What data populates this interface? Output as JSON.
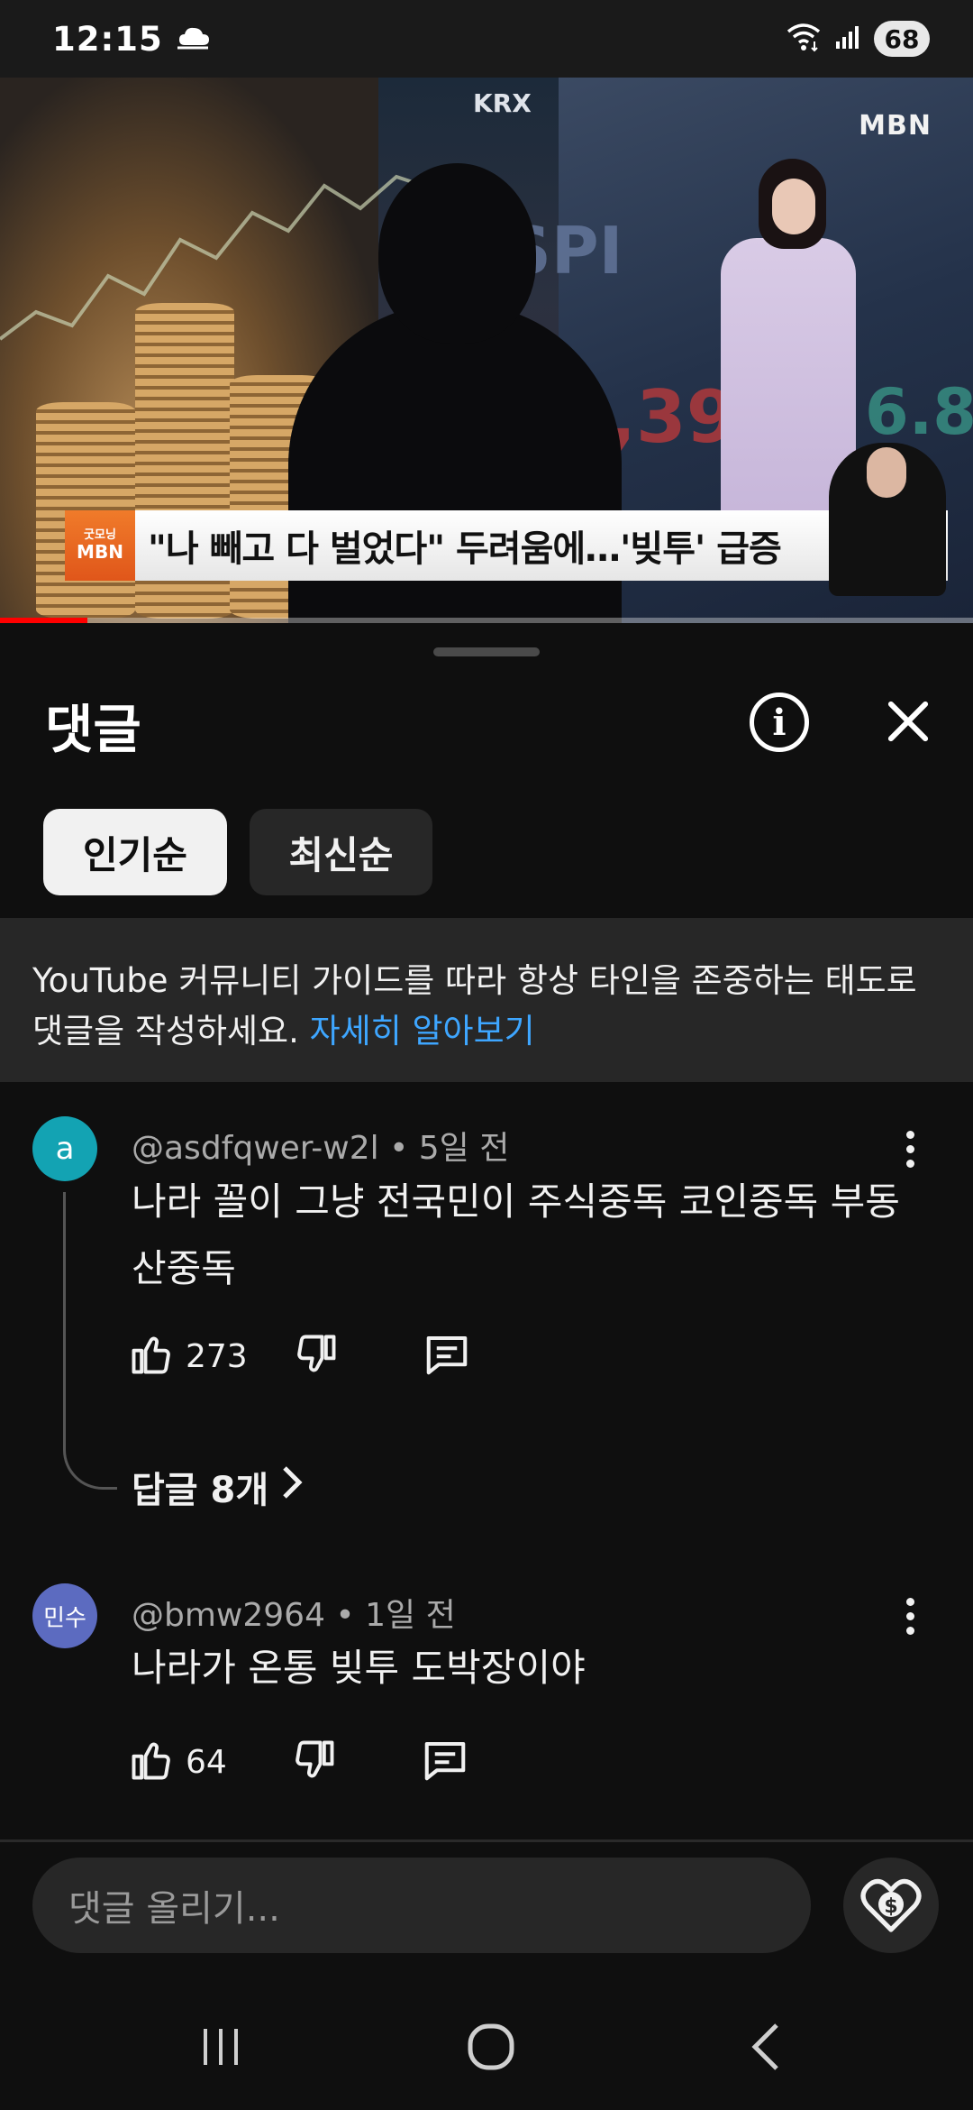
{
  "status_bar": {
    "time": "12:15",
    "battery": "68"
  },
  "video": {
    "channel_logo": "MBN",
    "krx_sign": "KRX",
    "caption_logo_small": "굿모닝",
    "caption_logo": "MBN",
    "caption": "\"나 빼고 다 벌었다\" 두려움에…'빚투' 급증",
    "progress": 0.09
  },
  "comments_panel": {
    "title": "댓글",
    "sort_chips": [
      {
        "label": "인기순",
        "selected": true
      },
      {
        "label": "최신순",
        "selected": false
      }
    ],
    "guideline_text": "YouTube 커뮤니티 가이드를 따라 항상 타인을 존중하는 태도로 댓글을 작성하세요.",
    "guideline_link": "자세히 알아보기",
    "comments": [
      {
        "avatar_text": "a",
        "avatar_color": "#13a3b3",
        "author": "@asdfqwer-w2l",
        "time": "5일 전",
        "text": "나라 꼴이 그냥 전국민이 주식중독 코인중독 부동산중독",
        "likes": "273",
        "replies_label": "답글 8개"
      },
      {
        "avatar_text": "민수",
        "avatar_color": "#5c6bc0",
        "author": "@bmw2964",
        "time": "1일 전",
        "text": "나라가 온통 빚투 도박장이야",
        "likes": "64"
      }
    ],
    "input_placeholder": "댓글 올리기..."
  },
  "icons": {
    "status": [
      "cloud-upload-icon",
      "wifi-icon",
      "signal-icon"
    ],
    "panel": [
      "info-icon",
      "close-icon"
    ],
    "comment_actions": [
      "thumbs-up-icon",
      "thumbs-down-icon",
      "reply-icon",
      "more-vert-icon",
      "chevron-right-icon"
    ],
    "input": "super-thanks-icon",
    "navigation": [
      "recents-icon",
      "home-icon",
      "back-icon"
    ]
  },
  "colors": {
    "background": "#0f0f0f",
    "link": "#3ea6ff",
    "chip_active": "#f1f1f1",
    "chip_inactive": "#272727"
  }
}
